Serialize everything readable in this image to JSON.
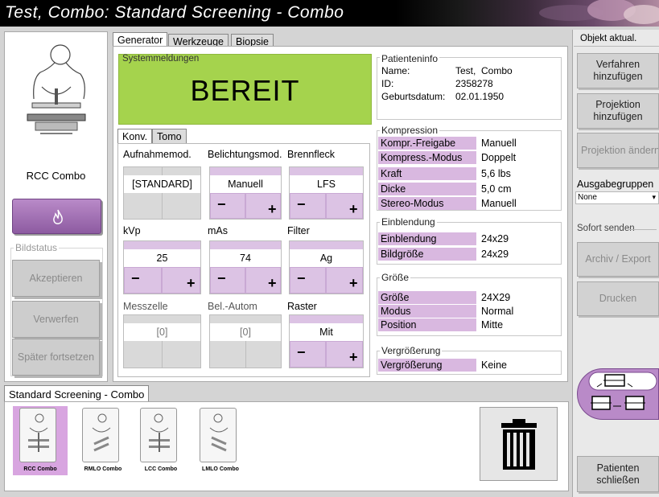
{
  "window": {
    "title": "Test,  Combo:  Standard Screening - Combo"
  },
  "left": {
    "view_name": "RCC Combo",
    "image_status_label": "Bildstatus",
    "buttons": {
      "accept": "Akzeptieren",
      "reject": "Verwerfen",
      "later": "Später fortsetzen"
    }
  },
  "tabs": {
    "generator": "Generator",
    "tools": "Werkzeuge",
    "biopsy": "Biopsie"
  },
  "system": {
    "label": "Systemmeldungen",
    "status": "BEREIT"
  },
  "patient": {
    "title": "Patienteninfo",
    "name_label": "Name:",
    "name": "Test,  Combo",
    "id_label": "ID:",
    "id": "2358278",
    "dob_label": "Geburtsdatum:",
    "dob": "02.01.1950"
  },
  "mode_tabs": {
    "conv": "Konv.",
    "tomo": "Tomo"
  },
  "controls": {
    "acq_mode": {
      "label": "Aufnahmemod.",
      "value": "[STANDARD]"
    },
    "exposure_mode": {
      "label": "Belichtungsmod.",
      "value": "Manuell"
    },
    "focal_spot": {
      "label": "Brennfleck",
      "value": "LFS"
    },
    "kvp": {
      "label": "kVp",
      "value": "25"
    },
    "mas": {
      "label": "mAs",
      "value": "74"
    },
    "filter": {
      "label": "Filter",
      "value": "Ag"
    },
    "cell": {
      "label": "Messzelle",
      "value": "[0]"
    },
    "aec": {
      "label": "Bel.-Autom",
      "value": "[0]"
    },
    "grid": {
      "label": "Raster",
      "value": "Mit"
    },
    "minus": "−",
    "plus": "+"
  },
  "compression": {
    "title": "Kompression",
    "rows": [
      {
        "label": "Kompr.-Freigabe",
        "value": "Manuell"
      },
      {
        "label": "Kompress.-Modus",
        "value": "Doppelt"
      },
      {
        "label": "Kraft",
        "value": "5,6 lbs"
      },
      {
        "label": "Dicke",
        "value": "5,0 cm"
      },
      {
        "label": "Stereo-Modus",
        "value": "Manuell"
      }
    ]
  },
  "collimation": {
    "title": "Einblendung",
    "rows": [
      {
        "label": "Einblendung",
        "value": "24x29"
      },
      {
        "label": "Bildgröße",
        "value": "24x29"
      }
    ]
  },
  "size": {
    "title": "Größe",
    "rows": [
      {
        "label": "Größe",
        "value": "24X29"
      },
      {
        "label": "Modus",
        "value": "Normal"
      },
      {
        "label": "Position",
        "value": "Mitte"
      }
    ]
  },
  "magnification": {
    "title": "Vergrößerung",
    "rows": [
      {
        "label": "Vergrößerung",
        "value": "Keine"
      }
    ]
  },
  "procedure": {
    "tab": "Standard Screening - Combo",
    "thumbnails": [
      "RCC Combo",
      "RMLO Combo",
      "LCC Combo",
      "LMLO Combo"
    ]
  },
  "right": {
    "header": "Objekt aktual.",
    "add_procedure": "Verfahren hinzufügen",
    "add_view": "Projektion hinzufügen",
    "edit_view": "Projektion ändern",
    "output_groups_label": "Ausgabegruppen",
    "output_groups_value": "None",
    "send_now_label": "Sofort senden",
    "archive_export": "Archiv  / Export",
    "print": "Drucken",
    "close_patient": "Patienten schließen"
  },
  "colors": {
    "status_green": "#a5d34d",
    "accent_purple": "#d9b8e0",
    "selected_thumb": "#d8a5e0"
  },
  "icons": [
    "breast-positioning-icon",
    "flame-icon",
    "trash-icon",
    "paddle-shift-icon",
    "dropdown-arrow-icon"
  ]
}
